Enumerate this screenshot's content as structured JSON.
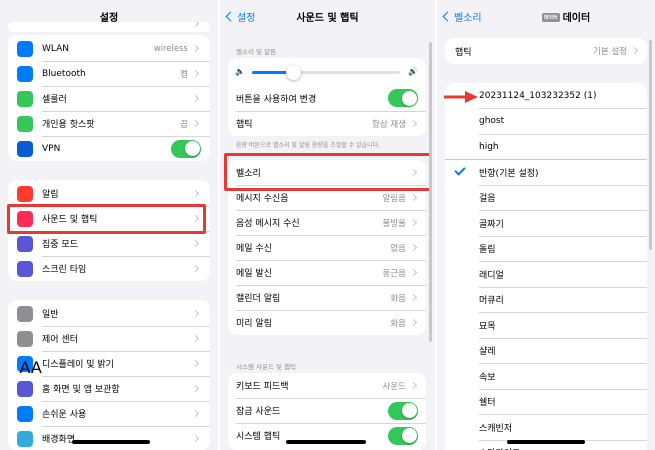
{
  "colors": {
    "accent": "#007aff",
    "toggle_on": "#34c759",
    "highlight": "#e53935",
    "background": "#f2f2f7"
  },
  "settings": {
    "title": "설정",
    "group1": [
      {
        "label": "WLAN",
        "value": "wireless",
        "icon": "wifi-icon",
        "color": "#007aff"
      },
      {
        "label": "Bluetooth",
        "value": "켬",
        "icon": "bluetooth-icon",
        "color": "#007aff"
      },
      {
        "label": "셀룰러",
        "value": "",
        "icon": "cellular-icon",
        "color": "#34c759"
      },
      {
        "label": "개인용 핫스팟",
        "value": "끔",
        "icon": "hotspot-icon",
        "color": "#34c759"
      },
      {
        "label": "VPN",
        "value": "",
        "icon": "vpn-icon",
        "color": "#0a5cd6",
        "toggle": true
      }
    ],
    "group2": [
      {
        "label": "알림",
        "icon": "bell-icon",
        "color": "#ff3b30"
      },
      {
        "label": "사운드 및 햅틱",
        "icon": "speaker-icon",
        "color": "#ff2d55"
      },
      {
        "label": "집중 모드",
        "icon": "moon-icon",
        "color": "#5856d6"
      },
      {
        "label": "스크린 타임",
        "icon": "hourglass-icon",
        "color": "#5856d6"
      }
    ],
    "group3": [
      {
        "label": "일반",
        "icon": "gear-icon",
        "color": "#8e8e93"
      },
      {
        "label": "제어 센터",
        "icon": "control-center-icon",
        "color": "#8e8e93"
      },
      {
        "label": "디스플레이 및 밝기",
        "icon": "display-icon",
        "color": "#007aff"
      },
      {
        "label": "홈 화면 및 앱 보관함",
        "icon": "home-screen-icon",
        "color": "#5856d6"
      },
      {
        "label": "손쉬운 사용",
        "icon": "accessibility-icon",
        "color": "#007aff"
      },
      {
        "label": "배경화면",
        "icon": "wallpaper-icon",
        "color": "#34aadc"
      }
    ]
  },
  "sounds": {
    "back": "설정",
    "title": "사운드 및 햅틱",
    "section_volume": "벨소리 및 알림",
    "volume_level": 0.28,
    "change_with_buttons": "버튼을 사용하여 변경",
    "haptics": {
      "label": "햅틱",
      "value": "항상 재생"
    },
    "note": "음량 버튼으로 벨소리 및 알림 음량을 조절할 수 있습니다.",
    "tones": [
      {
        "label": "벨소리",
        "value": ""
      },
      {
        "label": "메시지 수신음",
        "value": "알림음"
      },
      {
        "label": "음성 메시지 수신",
        "value": "물방울"
      },
      {
        "label": "메일 수신",
        "value": "없음"
      },
      {
        "label": "메일 발신",
        "value": "둥근음"
      },
      {
        "label": "캘린더 알림",
        "value": "화음"
      },
      {
        "label": "미리 알림",
        "value": "화음"
      }
    ],
    "section_system": "시스템 사운드 및 햅틱",
    "system": [
      {
        "label": "키보드 피드백",
        "value": "사운드"
      },
      {
        "label": "잠금 사운드",
        "value": "",
        "toggle": true
      },
      {
        "label": "시스템 햅틱",
        "value": "",
        "toggle": true
      }
    ]
  },
  "ringtones": {
    "back": "벨소리",
    "badge": "데이터",
    "title": "데이터",
    "haptics": {
      "label": "햅틱",
      "value": "기본 설정"
    },
    "items": [
      {
        "label": "20231124_103232352 (1)",
        "checked": false
      },
      {
        "label": "ghost",
        "checked": false
      },
      {
        "label": "high",
        "checked": false
      },
      {
        "label": "반향(기본 설정)",
        "checked": true
      },
      {
        "label": "걸음",
        "checked": false
      },
      {
        "label": "골짜기",
        "checked": false
      },
      {
        "label": "돌림",
        "checked": false
      },
      {
        "label": "래디얼",
        "checked": false
      },
      {
        "label": "머큐리",
        "checked": false
      },
      {
        "label": "묘목",
        "checked": false
      },
      {
        "label": "샬레",
        "checked": false
      },
      {
        "label": "속보",
        "checked": false
      },
      {
        "label": "쉘터",
        "checked": false
      },
      {
        "label": "스캐빈저",
        "checked": false
      },
      {
        "label": "스타라이트",
        "checked": false
      }
    ]
  }
}
